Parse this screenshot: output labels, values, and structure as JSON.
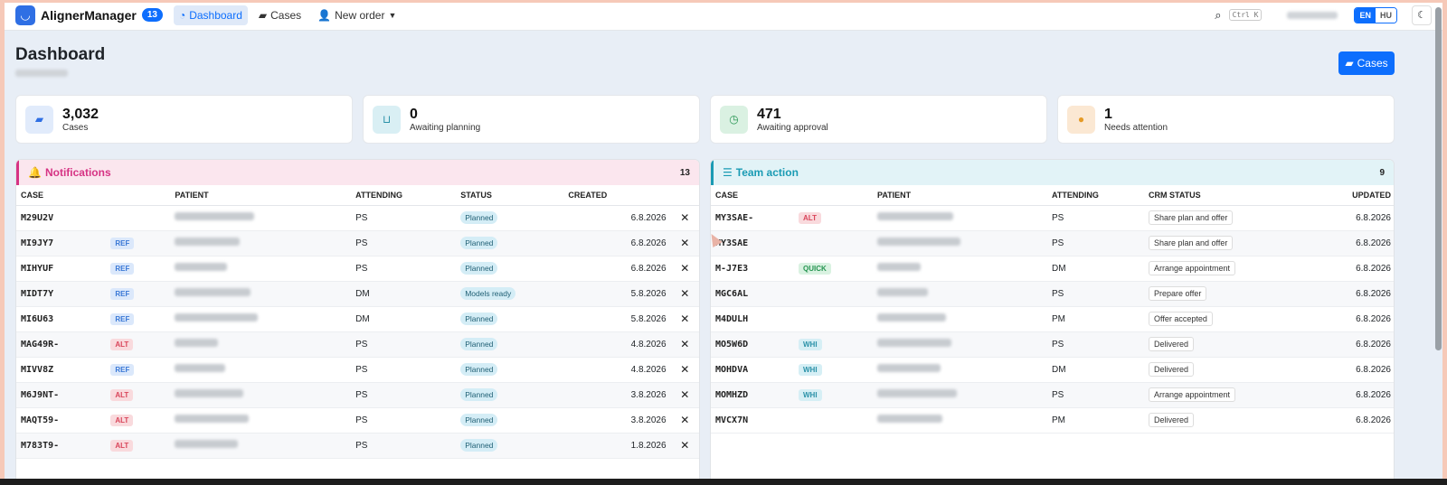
{
  "navbar": {
    "brand": "AlignerManager",
    "brand_badge": "13",
    "links": [
      {
        "label": "Dashboard",
        "icon": "dashboard-icon",
        "active": true
      },
      {
        "label": "Cases",
        "icon": "folder-icon",
        "active": false
      },
      {
        "label": "New order",
        "icon": "user-plus-icon",
        "active": false
      }
    ],
    "shortcut": "Ctrl K",
    "lang_en": "EN",
    "lang_hu": "HU"
  },
  "header": {
    "title": "Dashboard",
    "cases_button": "Cases"
  },
  "stats": [
    {
      "value": "3,032",
      "label": "Cases",
      "icon": "folder-open-icon",
      "color": "#2f6fe4",
      "bg": "#e1ebfb"
    },
    {
      "value": "0",
      "label": "Awaiting planning",
      "icon": "inbox-icon",
      "color": "#2a91a8",
      "bg": "#d9eff4"
    },
    {
      "value": "471",
      "label": "Awaiting approval",
      "icon": "clock-icon",
      "color": "#279552",
      "bg": "#daf1e2"
    },
    {
      "value": "1",
      "label": "Needs attention",
      "icon": "alert-icon",
      "color": "#e59a25",
      "bg": "#fbe8d3"
    }
  ],
  "notifications": {
    "title": "Notifications",
    "count": "13",
    "accent": "#d63384",
    "columns": [
      "CASE",
      "PATIENT",
      "ATTENDING",
      "STATUS",
      "CREATED"
    ],
    "rows": [
      {
        "case": "M29U2V",
        "tag": "",
        "attending": "PS",
        "status": "Planned",
        "created": "6.8.2026"
      },
      {
        "case": "MI9JY7",
        "tag": "REF",
        "attending": "PS",
        "status": "Planned",
        "created": "6.8.2026"
      },
      {
        "case": "MIHYUF",
        "tag": "REF",
        "attending": "PS",
        "status": "Planned",
        "created": "6.8.2026"
      },
      {
        "case": "MIDT7Y",
        "tag": "REF",
        "attending": "DM",
        "status": "Models ready",
        "created": "5.8.2026"
      },
      {
        "case": "MI6U63",
        "tag": "REF",
        "attending": "DM",
        "status": "Planned",
        "created": "5.8.2026"
      },
      {
        "case": "MAG49R-",
        "tag": "ALT",
        "attending": "PS",
        "status": "Planned",
        "created": "4.8.2026"
      },
      {
        "case": "MIVV8Z",
        "tag": "REF",
        "attending": "PS",
        "status": "Planned",
        "created": "4.8.2026"
      },
      {
        "case": "M6J9NT-",
        "tag": "ALT",
        "attending": "PS",
        "status": "Planned",
        "created": "3.8.2026"
      },
      {
        "case": "MAQT59-",
        "tag": "ALT",
        "attending": "PS",
        "status": "Planned",
        "created": "3.8.2026"
      },
      {
        "case": "M783T9-",
        "tag": "ALT",
        "attending": "PS",
        "status": "Planned",
        "created": "1.8.2026"
      }
    ]
  },
  "team_action": {
    "title": "Team action",
    "count": "9",
    "accent": "#1a9bb4",
    "columns": [
      "CASE",
      "PATIENT",
      "ATTENDING",
      "CRM STATUS",
      "UPDATED"
    ],
    "rows": [
      {
        "case": "MY3SAE-",
        "tag": "ALT",
        "attending": "PS",
        "crm": "Share plan and offer",
        "updated": "6.8.2026"
      },
      {
        "case": "MY3SAE",
        "tag": "",
        "attending": "PS",
        "crm": "Share plan and offer",
        "updated": "6.8.2026"
      },
      {
        "case": "M-J7E3",
        "tag": "QUICK",
        "attending": "DM",
        "crm": "Arrange appointment",
        "updated": "6.8.2026"
      },
      {
        "case": "MGC6AL",
        "tag": "",
        "attending": "PS",
        "crm": "Prepare offer",
        "updated": "6.8.2026"
      },
      {
        "case": "M4DULH",
        "tag": "",
        "attending": "PM",
        "crm": "Offer accepted",
        "updated": "6.8.2026"
      },
      {
        "case": "MO5W6D",
        "tag": "WHI",
        "attending": "PS",
        "crm": "Delivered",
        "updated": "6.8.2026"
      },
      {
        "case": "MOHDVA",
        "tag": "WHI",
        "attending": "DM",
        "crm": "Delivered",
        "updated": "6.8.2026"
      },
      {
        "case": "MOMHZD",
        "tag": "WHI",
        "attending": "PS",
        "crm": "Arrange appointment",
        "updated": "6.8.2026"
      },
      {
        "case": "MVCX7N",
        "tag": "",
        "attending": "PM",
        "crm": "Delivered",
        "updated": "6.8.2026"
      }
    ]
  }
}
